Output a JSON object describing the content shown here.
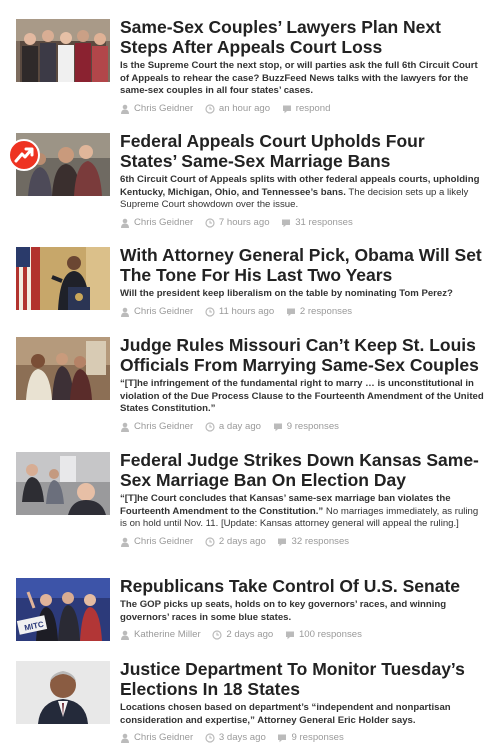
{
  "stories": [
    {
      "headline": "Same-Sex Couples’ Lawyers Plan Next Steps After Appeals Court Loss",
      "summary": [
        {
          "t": "Is the Supreme Court the next stop, or will parties ask the full 6th Circuit Court of Appeals to rehear the case? BuzzFeed News talks with the lawyers for the same-sex couples in all four states’ cases.",
          "b": true
        }
      ],
      "author": "Chris Geidner",
      "time": "an hour ago",
      "responses": "respond",
      "thumb_icon": "couples-group-photo",
      "has_badge": false
    },
    {
      "headline": "Federal Appeals Court Upholds Four States’ Same-Sex Marriage Bans",
      "summary": [
        {
          "t": "6th Circuit Court of Appeals splits with other federal appeals courts, upholding Kentucky, Michigan, Ohio, and Tennessee’s bans.",
          "b": true
        },
        {
          "t": " The decision sets up a likely Supreme Court showdown over the issue.",
          "b": false
        }
      ],
      "author": "Chris Geidner",
      "time": "7 hours ago",
      "responses": "31 responses",
      "thumb_icon": "embracing-couple-photo",
      "has_badge": true
    },
    {
      "headline": "With Attorney General Pick, Obama Will Set The Tone For His Last Two Years",
      "summary": [
        {
          "t": "Will the president keep liberalism on the table by nominating Tom Perez?",
          "b": true
        }
      ],
      "author": "Chris Geidner",
      "time": "11 hours ago",
      "responses": "2 responses",
      "thumb_icon": "president-podium-photo",
      "has_badge": false
    },
    {
      "headline": "Judge Rules Missouri Can’t Keep St. Louis Officials From Marrying Same-Sex Couples",
      "summary": [
        {
          "t": "“[T]he infringement of the fundamental right to marry … is unconstitutional in violation of the Due Process Clause to the Fourteenth Amendment of the United States Constitution.”",
          "b": true
        }
      ],
      "author": "Chris Geidner",
      "time": "a day ago",
      "responses": "9 responses",
      "thumb_icon": "courthouse-photo",
      "has_badge": false
    },
    {
      "headline": "Federal Judge Strikes Down Kansas Same-Sex Marriage Ban On Election Day",
      "summary": [
        {
          "t": "“[T]he Court concludes that Kansas’ same-sex marriage ban violates the Fourteenth Amendment to the Constitution.”",
          "b": true
        },
        {
          "t": " No marriages immediately, as ruling is on hold until Nov. 11. [Update: Kansas attorney general will appeal the ruling.]",
          "b": false
        }
      ],
      "author": "Chris Geidner",
      "time": "2 days ago",
      "responses": "32 responses",
      "thumb_icon": "hallway-crowd-photo",
      "has_badge": false
    },
    {
      "headline": "Republicans Take Control Of U.S. Senate",
      "summary": [
        {
          "t": "The GOP picks up seats, holds on to key governors’ races, and winning governors’ races in some blue states.",
          "b": true
        }
      ],
      "author": "Katherine Miller",
      "time": "2 days ago",
      "responses": "100 responses",
      "thumb_icon": "election-rally-photo",
      "has_badge": false
    },
    {
      "headline": "Justice Department To Monitor Tuesday’s Elections In 18 States",
      "summary": [
        {
          "t": "Locations chosen based on department’s “independent and nonpartisan consideration and expertise,” Attorney General Eric Holder says.",
          "b": true
        }
      ],
      "author": "Chris Geidner",
      "time": "3 days ago",
      "responses": "9 responses",
      "thumb_icon": "attorney-general-portrait",
      "has_badge": false
    }
  ],
  "colors": {
    "accent": "#ee3322",
    "meta": "#9a9a9a",
    "headline": "#222222"
  }
}
